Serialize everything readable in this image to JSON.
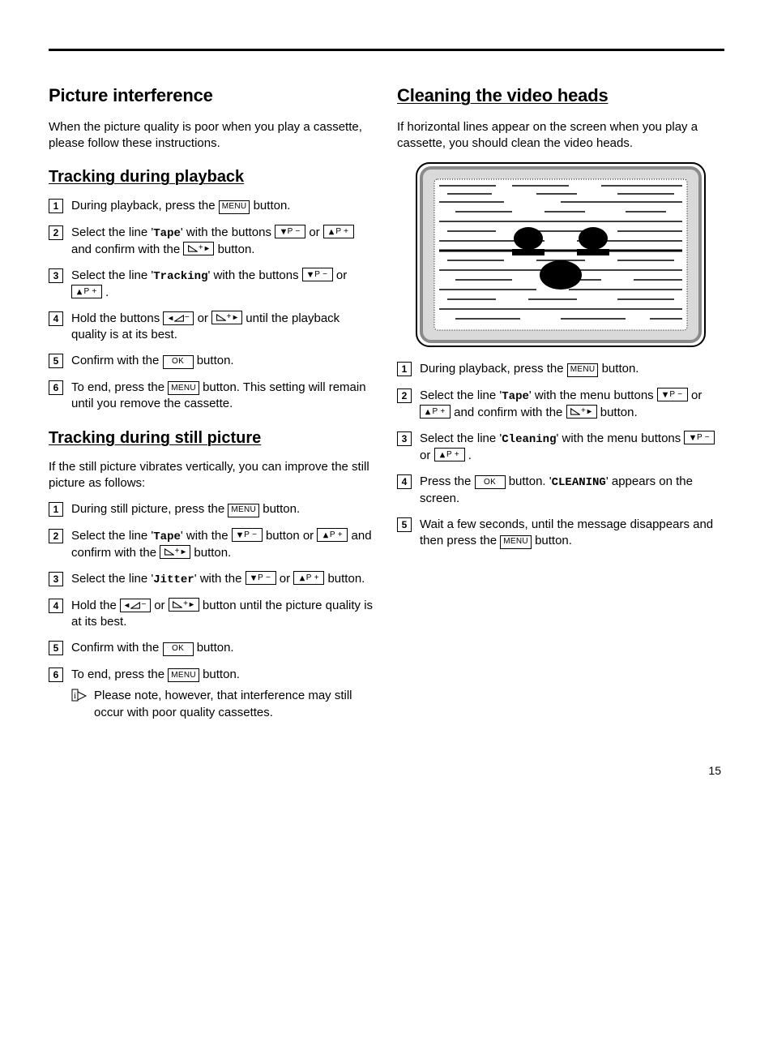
{
  "page_number": "15",
  "buttons": {
    "menu": "MENU",
    "ok": "OK",
    "p_plus": "P +",
    "p_minus": "P −"
  },
  "left": {
    "h_interference": "Picture interference",
    "p_interference": "When the picture quality is poor when you play a cassette, please follow these instructions.",
    "h_tracking_play": "Tracking during playback",
    "steps_play": [
      {
        "pre": "During playback, press the ",
        "post_menu": " button."
      },
      {
        "pre": "Select the line '",
        "tape": "Tape",
        "mid1": "' with the buttons ",
        "or": " or ",
        "mid2": " and confirm with the ",
        "post": " button."
      },
      {
        "pre": "Select the line '",
        "tracking": "Tracking",
        "mid1": "' with the buttons ",
        "or": " or ",
        "post": "."
      },
      {
        "pre": "Hold the buttons ",
        "or": " or ",
        "post": " until the playback quality is at its best."
      },
      {
        "pre": "Confirm with the ",
        "post": " button."
      },
      {
        "pre": "To end, press the ",
        "post": " button. This setting will remain until you remove the cassette."
      }
    ],
    "h_tracking_still": "Tracking during still picture",
    "p_still": "If the still picture vibrates vertically, you can improve the still picture as follows:",
    "steps_still": [
      {
        "pre": "During still picture, press the ",
        "post": " button."
      },
      {
        "pre": "Select the line '",
        "tape": "Tape",
        "mid1": "' with the ",
        "mid2": " button or ",
        "mid3": " and confirm with the ",
        "post": " button."
      },
      {
        "pre": "Select the line '",
        "jitter": "Jitter",
        "mid1": "' with the ",
        "or": " or ",
        "post": " button."
      },
      {
        "pre": "Hold the ",
        "or": " or ",
        "post": " button until the picture quality is at its best."
      },
      {
        "pre": "Confirm with the ",
        "post": " button."
      },
      {
        "pre": "To end, press the ",
        "post": " button."
      }
    ],
    "note": "Please note, however, that interference may still occur with poor quality cassettes."
  },
  "right": {
    "h_cleaning": "Cleaning the video heads",
    "p_cleaning": "If horizontal lines appear on the screen when you play a cassette, you should clean the video heads.",
    "steps": [
      {
        "pre": "During playback, press the ",
        "post": " button."
      },
      {
        "pre": "Select the line '",
        "tape": "Tape",
        "mid1": "' with the menu buttons ",
        "or": " or ",
        "mid2": " and confirm with the ",
        "post": " button."
      },
      {
        "pre": "Select the line '",
        "cleaning": "Cleaning",
        "mid1": "' with the menu buttons ",
        "or": " or ",
        "post": "."
      },
      {
        "pre": "Press the ",
        "mid": " button. '",
        "CLEANING": "CLEANING",
        "post": "' appears on the screen."
      },
      {
        "pre": "Wait a few seconds, until the message disappears and then press the ",
        "post": " button."
      }
    ]
  }
}
